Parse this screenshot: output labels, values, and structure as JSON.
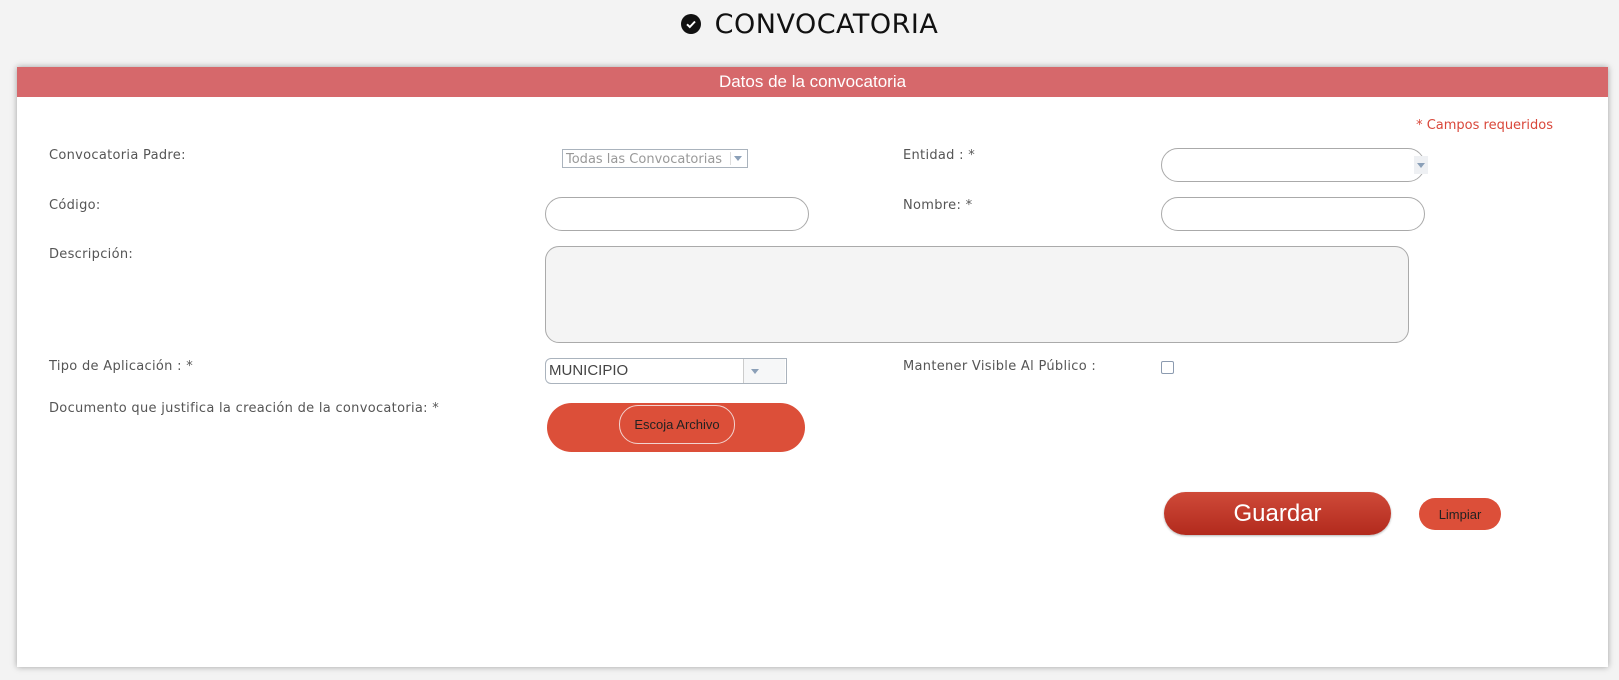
{
  "page": {
    "title": "CONVOCATORIA"
  },
  "panel": {
    "title": "Datos de la convocatoria",
    "required_note": "* Campos requeridos"
  },
  "form": {
    "convocatoria_padre": {
      "label": "Convocatoria Padre:",
      "value": "Todas las Convocatorias"
    },
    "entidad": {
      "label": "Entidad : *",
      "value": ""
    },
    "codigo": {
      "label": "Código:",
      "value": ""
    },
    "nombre": {
      "label": "Nombre: *",
      "value": ""
    },
    "descripcion": {
      "label": "Descripción:",
      "value": ""
    },
    "tipo_aplicacion": {
      "label": "Tipo de Aplicación : *",
      "value": "MUNICIPIO"
    },
    "mantener_visible": {
      "label": "Mantener Visible Al Público :",
      "checked": false
    },
    "documento": {
      "label": "Documento que justifica la creación de la convocatoria: *",
      "button_label": "Escoja Archivo"
    }
  },
  "actions": {
    "guardar": "Guardar",
    "limpiar": "Limpiar"
  },
  "colors": {
    "header_bar": "#d6686b",
    "accent_red": "#dc4f39",
    "required_text": "#d9473a"
  },
  "icons": {
    "title_icon": "check-circle-icon",
    "dropdown_icon": "chevron-down-icon"
  }
}
